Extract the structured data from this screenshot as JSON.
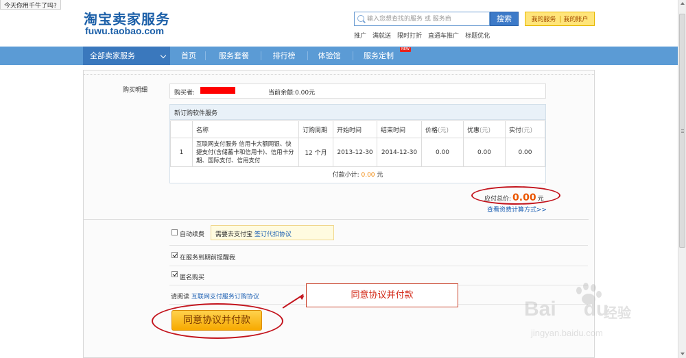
{
  "topbar": {
    "greeting": "今天你用千牛了吗?"
  },
  "logo": {
    "cn": "淘宝卖家服务",
    "en": "fuwu.taobao.com"
  },
  "search": {
    "placeholder": "输入您想查找的服务 或 服务商",
    "button": "搜索"
  },
  "quick_links": [
    "推广",
    "满就送",
    "限时打折",
    "直通车推广",
    "标题优化"
  ],
  "account": {
    "my_service": "我的服务",
    "my_account": "我的账户"
  },
  "nav": {
    "category": "全部卖家服务",
    "items": [
      "首页",
      "服务套餐",
      "排行榜",
      "体验馆",
      "服务定制"
    ],
    "badge": "NEW"
  },
  "purchase": {
    "section_label": "购买明细",
    "buyer_label": "购买者:",
    "balance_label": "当前余额:",
    "balance_value": "0.00元",
    "order_title": "新订购软件服务",
    "columns": [
      "名称",
      "订购周期",
      "开始时间",
      "结束时间",
      "价格",
      "优惠",
      "实付"
    ],
    "unit": "(元)",
    "rows": [
      {
        "index": "1",
        "name": "互联网支付服务 信用卡大额网银、快捷支付(含储蓄卡和信用卡)、信用卡分期、国际支付、信用支付",
        "period": "12 个月",
        "start": "2013-12-30",
        "end": "2014-12-30",
        "price": "0.00",
        "discount": "0.00",
        "paid": "0.00"
      }
    ],
    "subtotal_label": "付款小计:",
    "subtotal_value": "0.00",
    "subtotal_unit": "元",
    "total_label": "应付总价:",
    "total_value": "0.00",
    "total_unit": "元",
    "calc_link": "查看资费计算方式>>"
  },
  "options": {
    "auto_renew": {
      "label": "自动续费",
      "checked": false
    },
    "tip_text": "需要去支付宝",
    "tip_link": "签订代扣协议",
    "remind": {
      "label": "在服务到期前提醒我",
      "checked": true
    },
    "anonymous": {
      "label": "匿名购买",
      "checked": true
    }
  },
  "agreement": {
    "prefix": "请阅读",
    "link": "互联网支付服务订购协议"
  },
  "pay_button": "同意协议并付款",
  "callout": "同意协议并付款",
  "watermark": {
    "brand": "Bai",
    "brand2": "du",
    "cn": "经验",
    "url": "jingyan.baidu.com"
  },
  "colors": {
    "brand_blue": "#1b5fa8",
    "nav_blue": "#5b9bd5",
    "accent_orange": "#ea5500",
    "annotation_red": "#c3141d"
  }
}
